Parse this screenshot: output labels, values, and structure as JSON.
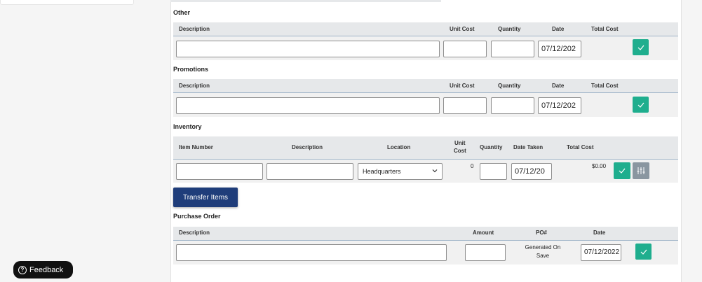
{
  "sections": {
    "other": {
      "title": "Other",
      "headers": {
        "description": "Description",
        "unit_cost": "Unit Cost",
        "quantity": "Quantity",
        "date": "Date",
        "total_cost": "Total Cost"
      },
      "date_value": "07/12/202"
    },
    "promotions": {
      "title": "Promotions",
      "headers": {
        "description": "Description",
        "unit_cost": "Unit Cost",
        "quantity": "Quantity",
        "date": "Date",
        "total_cost": "Total Cost"
      },
      "date_value": "07/12/202"
    },
    "inventory": {
      "title": "Inventory",
      "headers": {
        "item_number": "Item Number",
        "description": "Description",
        "location": "Location",
        "unit_cost_1": "Unit",
        "unit_cost_2": "Cost",
        "quantity": "Quantity",
        "date_taken": "Date Taken",
        "total_cost": "Total Cost"
      },
      "location_value": "Headquarters",
      "unit_cost_value": "0",
      "date_value": "07/12/20",
      "total_value": "$0.00"
    },
    "purchase_order": {
      "title": "Purchase Order",
      "headers": {
        "description": "Description",
        "amount": "Amount",
        "po_number": "PO#",
        "date": "Date"
      },
      "po_value_1": "Generated On",
      "po_value_2": "Save",
      "date_value": "07/12/2022"
    }
  },
  "transfer_button": "Transfer Items",
  "feedback": {
    "label": "Feedback",
    "icon": "question-circle-icon"
  },
  "colors": {
    "accent_green": "#1fae8e",
    "primary_blue": "#1f3d7a",
    "header_bg": "#e6e8ea",
    "row_bg": "#f1f1f1",
    "gray_button": "#8a96a0"
  }
}
